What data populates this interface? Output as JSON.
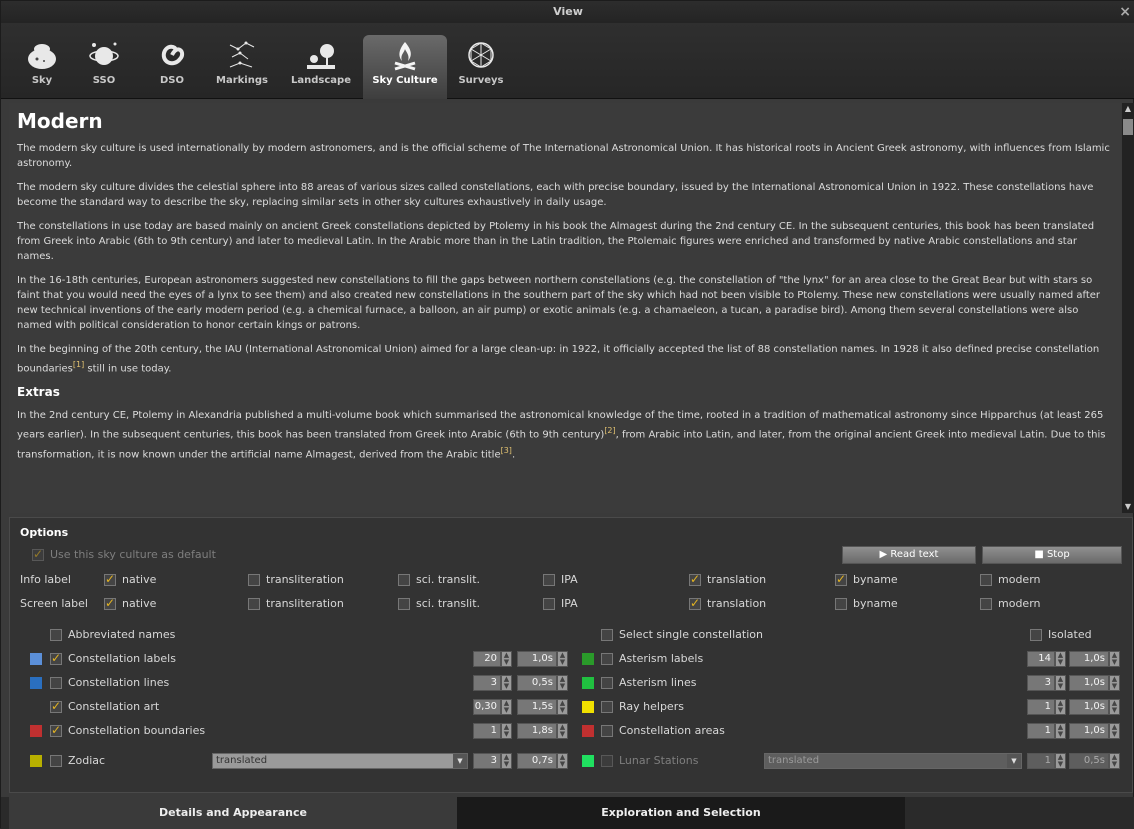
{
  "window": {
    "title": "View",
    "close": "×"
  },
  "tabs": [
    {
      "label": "Sky",
      "icon": "sky-icon"
    },
    {
      "label": "SSO",
      "icon": "sso-icon"
    },
    {
      "label": "DSO",
      "icon": "dso-icon"
    },
    {
      "label": "Markings",
      "icon": "markings-icon"
    },
    {
      "label": "Landscape",
      "icon": "landscape-icon"
    },
    {
      "label": "Sky Culture",
      "icon": "sky-culture-icon",
      "active": true
    },
    {
      "label": "Surveys",
      "icon": "surveys-icon"
    }
  ],
  "description": {
    "title": "Modern",
    "p1": "The modern sky culture is used internationally by modern astronomers, and is the official scheme of The International Astronomical Union. It has historical roots in Ancient Greek astronomy, with influences from Islamic astronomy.",
    "p2": "The modern sky culture divides the celestial sphere into 88 areas of various sizes called constellations, each with precise boundary, issued by the International Astronomical Union in 1922. These constellations have become the standard way to describe the sky, replacing similar sets in other sky cultures exhaustively in daily usage.",
    "p3": "The constellations in use today are based mainly on ancient Greek constellations depicted by Ptolemy in his book the Almagest during the 2nd century CE. In the subsequent centuries, this book has been translated from Greek into Arabic (6th to 9th century) and later to medieval Latin. In the Arabic more than in the Latin tradition, the Ptolemaic figures were enriched and transformed by native Arabic constellations and star names.",
    "p4": "In the 16-18th centuries, European astronomers suggested new constellations to fill the gaps between northern constellations (e.g. the constellation of \"the lynx\" for an area close to the Great Bear but with stars so faint that you would need the eyes of a lynx to see them) and also created new constellations in the southern part of the sky which had not been visible to Ptolemy. These new constellations were usually named after new technical inventions of the early modern period (e.g. a chemical furnace, a balloon, an air pump) or exotic animals (e.g. a chamaeleon, a tucan, a paradise bird). Among them several constellations were also named with political consideration to honor certain kings or patrons.",
    "p5a": "In the beginning of the 20th century, the IAU (International Astronomical Union) aimed for a large clean-up: in 1922, it officially accepted the list of 88 constellation names. In 1928 it also defined precise constellation boundaries",
    "p5ref": "[1]",
    "p5b": " still in use today.",
    "extras_title": "Extras",
    "p6a": "In the 2nd century CE, Ptolemy in Alexandria published a multi-volume book which summarised the astronomical knowledge of the time, rooted in a tradition of mathematical astronomy since Hipparchus (at least 265 years earlier). In the subsequent centuries, this book has been translated from Greek into Arabic (6th to 9th century)",
    "p6ref1": "[2]",
    "p6b": ", from Arabic into Latin, and later, from the original ancient Greek into medieval Latin. Due to this transformation, it is now known under the artificial name Almagest, derived from the Arabic title",
    "p6ref2": "[3]",
    "p6c": "."
  },
  "options": {
    "title": "Options",
    "use_default": "Use this sky culture as default",
    "read_text": "Read text",
    "stop": "Stop",
    "info_label": "Info label",
    "screen_label": "Screen label",
    "native": "native",
    "transliteration": "transliteration",
    "sci_translit": "sci. translit.",
    "ipa": "IPA",
    "translation": "translation",
    "byname": "byname",
    "modern": "modern",
    "abbreviated_names": "Abbreviated names",
    "select_single": "Select single constellation",
    "isolated": "Isolated",
    "constellation_labels": "Constellation labels",
    "constellation_lines": "Constellation lines",
    "constellation_art": "Constellation art",
    "constellation_boundaries": "Constellation boundaries",
    "zodiac": "Zodiac",
    "zodiac_combo": "translated",
    "asterism_labels": "Asterism labels",
    "asterism_lines": "Asterism lines",
    "ray_helpers": "Ray helpers",
    "constellation_areas": "Constellation areas",
    "lunar_stations": "Lunar Stations",
    "lunar_combo": "translated",
    "v_labels_size": "20",
    "v_labels_fade": "1,0s",
    "v_lines_width": "3",
    "v_lines_fade": "0,5s",
    "v_art_bright": "0,30",
    "v_art_fade": "1,5s",
    "v_bound_width": "1",
    "v_bound_fade": "1,8s",
    "v_zodiac_width": "3",
    "v_zodiac_fade": "0,7s",
    "v_ast_labels_size": "14",
    "v_ast_labels_fade": "1,0s",
    "v_ast_lines_width": "3",
    "v_ast_lines_fade": "1,0s",
    "v_ray_width": "1",
    "v_ray_fade": "1,0s",
    "v_areas_width": "1",
    "v_areas_fade": "1,0s",
    "v_lunar_width": "1",
    "v_lunar_fade": "0,5s",
    "colors": {
      "labels": "#5b8fd8",
      "lines": "#2a6fc0",
      "boundaries": "#c03030",
      "zodiac": "#b8b000",
      "ast_labels": "#2a9a2a",
      "ast_lines": "#20c040",
      "ray": "#f0e000",
      "areas": "#c03030",
      "lunar": "#20e060"
    }
  },
  "bottom_tabs": {
    "details": "Details and Appearance",
    "exploration": "Exploration and Selection"
  }
}
